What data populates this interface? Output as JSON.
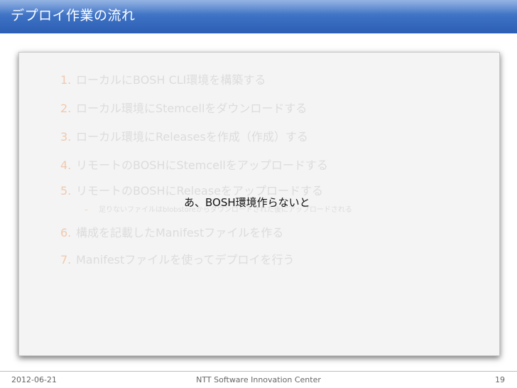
{
  "header": {
    "title": "デプロイ作業の流れ"
  },
  "list": {
    "items": [
      {
        "num": "1.",
        "text": "ローカルにBOSH CLI環境を構築する"
      },
      {
        "num": "2.",
        "text": "ローカル環境にStemcellをダウンロードする"
      },
      {
        "num": "3.",
        "text": "ローカル環境にReleasesを作成（作成）する"
      },
      {
        "num": "4.",
        "text": "リモートのBOSHにStemcellをアップロードする"
      },
      {
        "num": "5.",
        "text": "リモートのBOSHにReleaseをアップロードする"
      },
      {
        "num": "6.",
        "text": "構成を記載したManifestファイルを作る"
      },
      {
        "num": "7.",
        "text": "Manifestファイルを使ってデプロイを行う"
      }
    ],
    "sub": {
      "dash": "–",
      "text": "足りないファイルはblobstoreからダウンロードされた後にアップロードされる"
    }
  },
  "overlay": {
    "message": "あ、BOSH環境作らないと"
  },
  "footer": {
    "date": "2012-06-21",
    "center": "NTT Software Innovation Center",
    "page": "19"
  },
  "colors": {
    "header_blue": "#3b6fc2",
    "faded_text": "#dcdcdc",
    "faded_number": "#f0c9b0"
  }
}
